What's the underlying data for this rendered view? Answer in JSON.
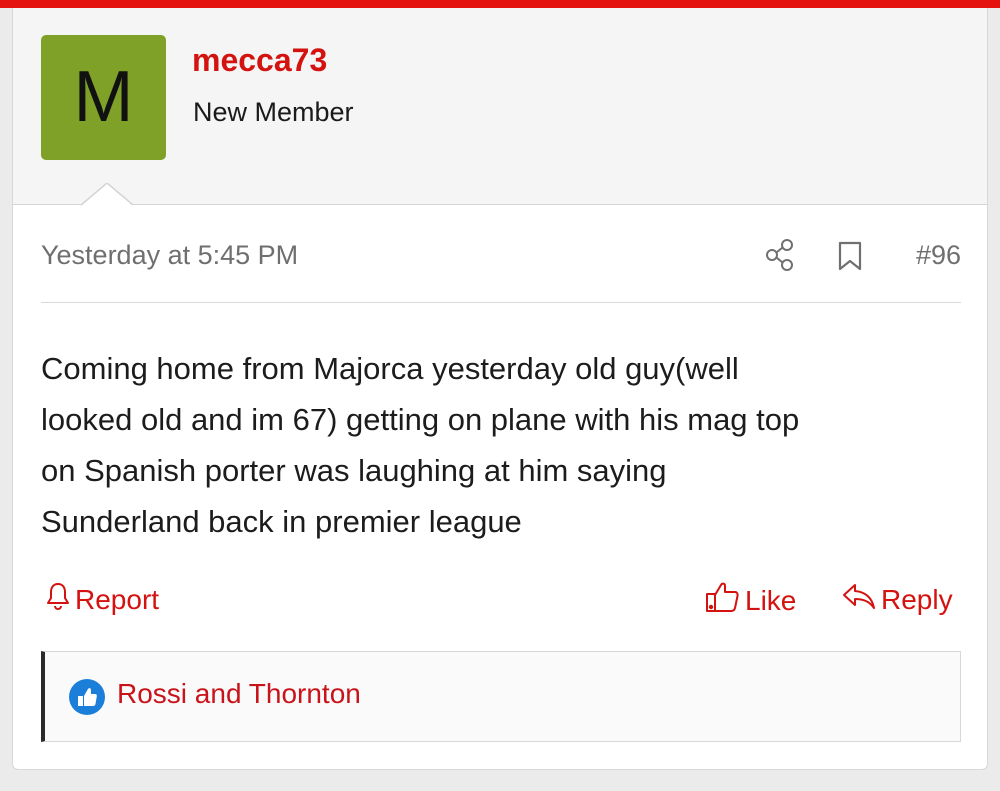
{
  "post": {
    "author": {
      "avatar_letter": "M",
      "avatar_color": "#7fa128",
      "username": "mecca73",
      "title": "New Member"
    },
    "date": "Yesterday at 5:45 PM",
    "number": "#96",
    "message_lines": [
      "Coming home from Majorca yesterday old guy(well",
      "looked old and im 67) getting on plane with his mag top",
      "on Spanish porter was laughing at him saying",
      "Sunderland back in premier league"
    ],
    "actions": {
      "report_label": "Report",
      "like_label": "Like",
      "reply_label": "Reply"
    },
    "reactions": {
      "names": "Rossi and Thornton",
      "icon": "thumbs-up-icon"
    }
  },
  "icons": {
    "share": "share-icon",
    "bookmark": "bookmark-icon",
    "report": "bell-icon",
    "like": "thumbs-up-outline-icon",
    "reply": "reply-arrow-icon"
  },
  "colors": {
    "accent": "#e4130f",
    "link": "#d4120f",
    "avatar_bg": "#7fa128",
    "reaction_blue": "#1b7fd9"
  }
}
